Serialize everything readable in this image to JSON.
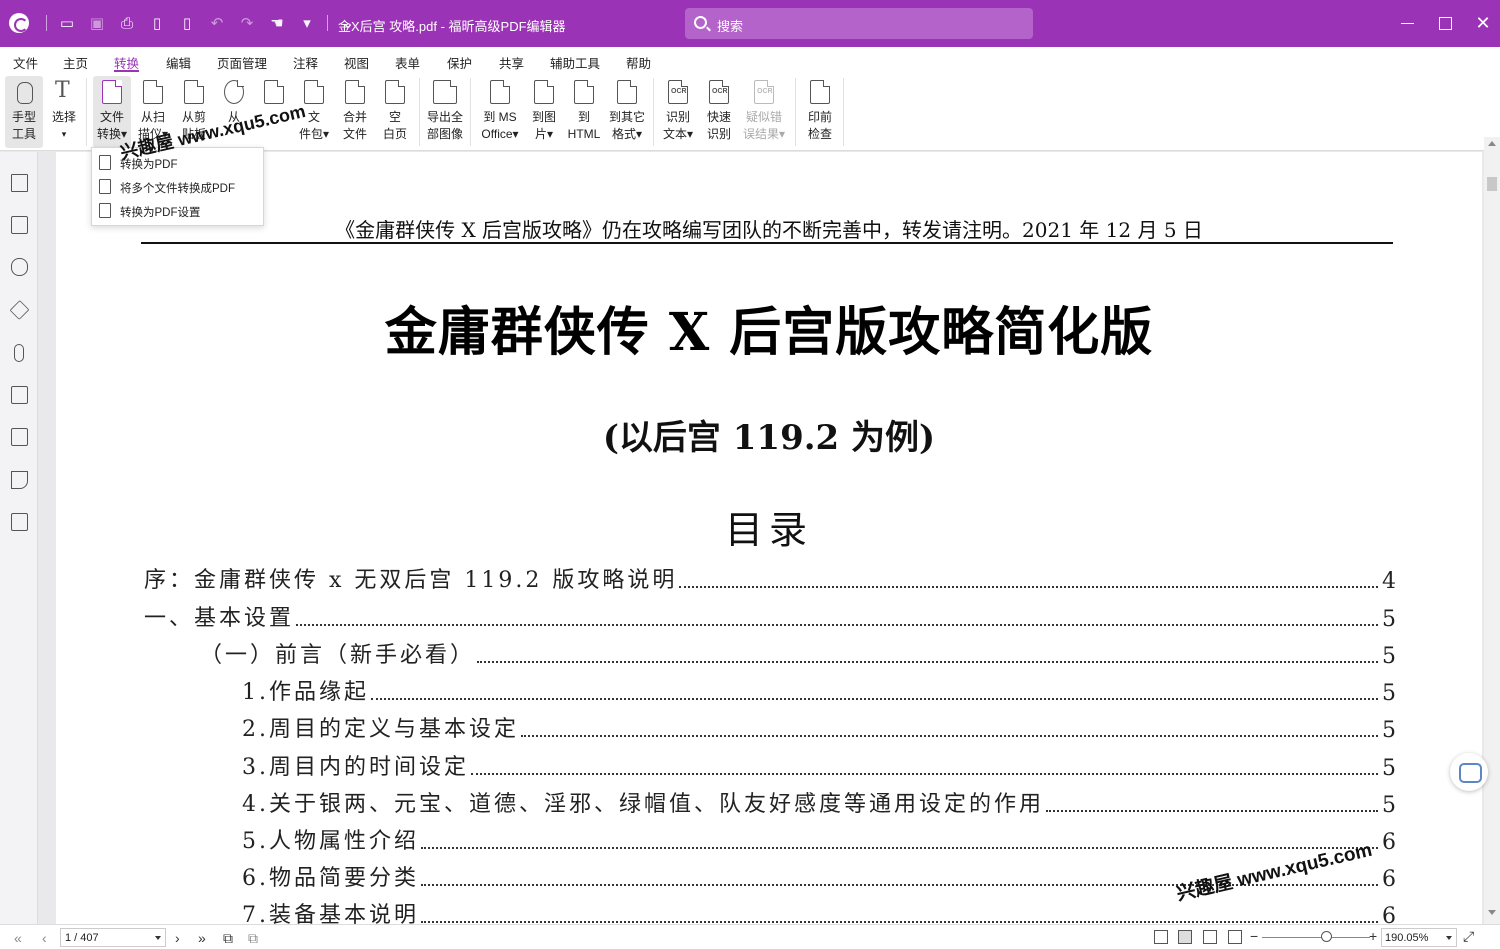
{
  "window": {
    "title": "金X后宫 攻略.pdf - 福昕高级PDF编辑器",
    "search_placeholder": "搜索"
  },
  "menu_tabs": [
    "文件",
    "主页",
    "转换",
    "编辑",
    "页面管理",
    "注释",
    "视图",
    "表单",
    "保护",
    "共享",
    "辅助工具",
    "帮助"
  ],
  "active_tab": "转换",
  "ribbon": {
    "hand_tool": [
      "手型",
      "工具"
    ],
    "select": [
      "选择",
      "▾"
    ],
    "file_convert": [
      "文件",
      "转换▾"
    ],
    "from_scanner": [
      "从扫",
      "描仪▾"
    ],
    "from_clipboard": [
      "从剪",
      "贴板"
    ],
    "from_web": [
      "从",
      ""
    ],
    "from_template": [
      "",
      ""
    ],
    "from_file": [
      "文",
      "件包▾"
    ],
    "merge_files": [
      "合并",
      "文件"
    ],
    "blank_page": [
      "空",
      "白页"
    ],
    "export_images": [
      "导出全",
      "部图像"
    ],
    "to_ms_office": [
      "到 MS",
      "Office▾"
    ],
    "to_image": [
      "到图",
      "片▾"
    ],
    "to_html": [
      "到",
      "HTML"
    ],
    "to_other": [
      "到其它",
      "格式▾"
    ],
    "ocr_text": [
      "识别",
      "文本▾"
    ],
    "quick_ocr": [
      "快速",
      "识别"
    ],
    "suspect_ocr": [
      "疑似错",
      "误结果▾"
    ],
    "preflight": [
      "印前",
      "检查"
    ]
  },
  "dropdown": {
    "items": [
      "转换为PDF",
      "将多个文件转换成PDF",
      "转换为PDF设置"
    ]
  },
  "document": {
    "header": "《金庸群侠传 X 后宫版攻略》仍在攻略编写团队的不断完善中，转发请注明。2021 年 12 月 5 日",
    "title": "金庸群侠传 X 后宫版攻略简化版",
    "subtitle": "(以后宫 119.2 为例)",
    "toc_title": "目录",
    "toc": [
      {
        "text": "序：金庸群侠传 x 无双后宫 119.2 版攻略说明",
        "page": "4",
        "level": 0
      },
      {
        "text": "一、基本设置",
        "page": "5",
        "level": 0
      },
      {
        "text": "（一）前言（新手必看）",
        "page": "5",
        "level": 1
      },
      {
        "text": "1.作品缘起",
        "page": "5",
        "level": 2
      },
      {
        "text": "2.周目的定义与基本设定",
        "page": "5",
        "level": 2
      },
      {
        "text": "3.周目内的时间设定",
        "page": "5",
        "level": 2
      },
      {
        "text": "4.关于银两、元宝、道德、淫邪、绿帽值、队友好感度等通用设定的作用",
        "page": "5",
        "level": 2
      },
      {
        "text": "5.人物属性介绍",
        "page": "6",
        "level": 2
      },
      {
        "text": "6.物品简要分类",
        "page": "6",
        "level": 2
      },
      {
        "text": "7.装备基本说明",
        "page": "6",
        "level": 2
      }
    ],
    "watermark": "兴趣屋 www.xqu5.com"
  },
  "statusbar": {
    "page_indicator": "1 / 407",
    "zoom": "190.05%"
  },
  "colors": {
    "accent": "#9b33b6",
    "titlebar": "#9b33b6"
  }
}
